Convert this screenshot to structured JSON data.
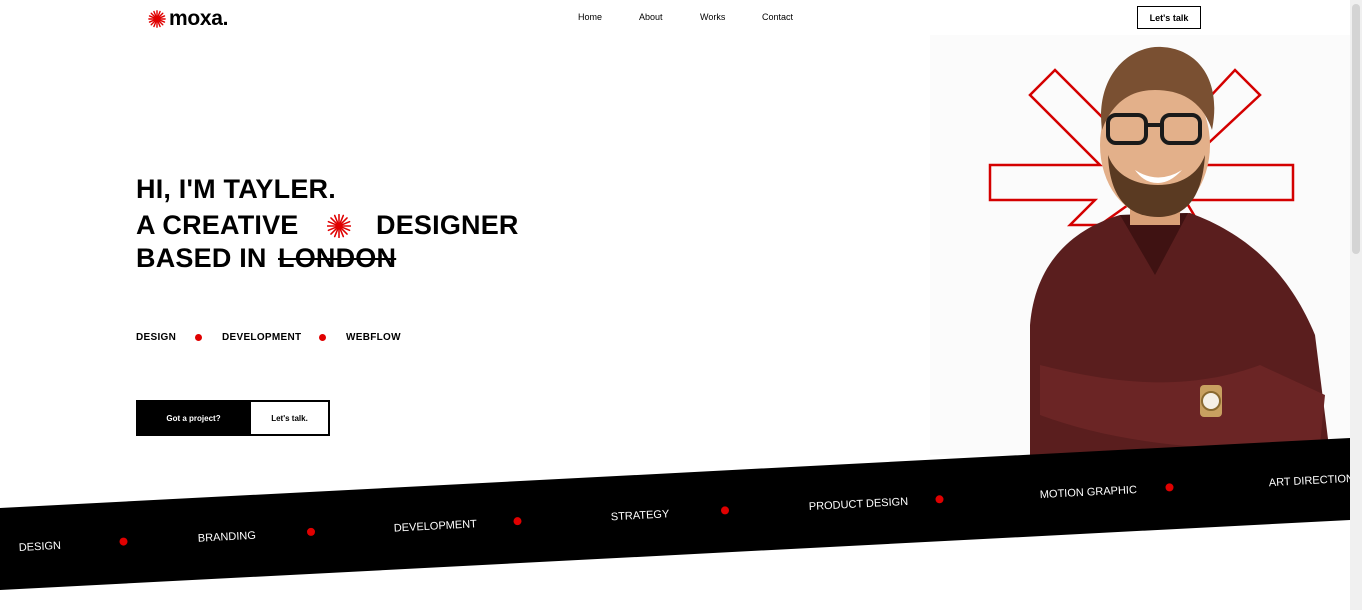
{
  "brand": {
    "name": "moxa.",
    "accent": "#e00000"
  },
  "nav": {
    "items": [
      "Home",
      "About",
      "Works",
      "Contact"
    ],
    "cta": "Let's talk"
  },
  "hero": {
    "line1": "HI, I'M TAYLER.",
    "line2a": "A CREATIVE",
    "line2b": "DESIGNER",
    "line3a": "BASED IN",
    "line3b": "LONDON",
    "skills": [
      "DESIGN",
      "DEVELOPMENT",
      "WEBFLOW"
    ],
    "button_primary": "Got a project?",
    "button_secondary": "Let's talk."
  },
  "ticker": {
    "items": [
      "DESIGN",
      "BRANDING",
      "DEVELOPMENT",
      "STRATEGY",
      "PRODUCT DESIGN",
      "MOTION GRAPHIC",
      "ART DIRECTION"
    ]
  },
  "image": {
    "subject": "portrait-of-smiling-man-with-glasses"
  }
}
